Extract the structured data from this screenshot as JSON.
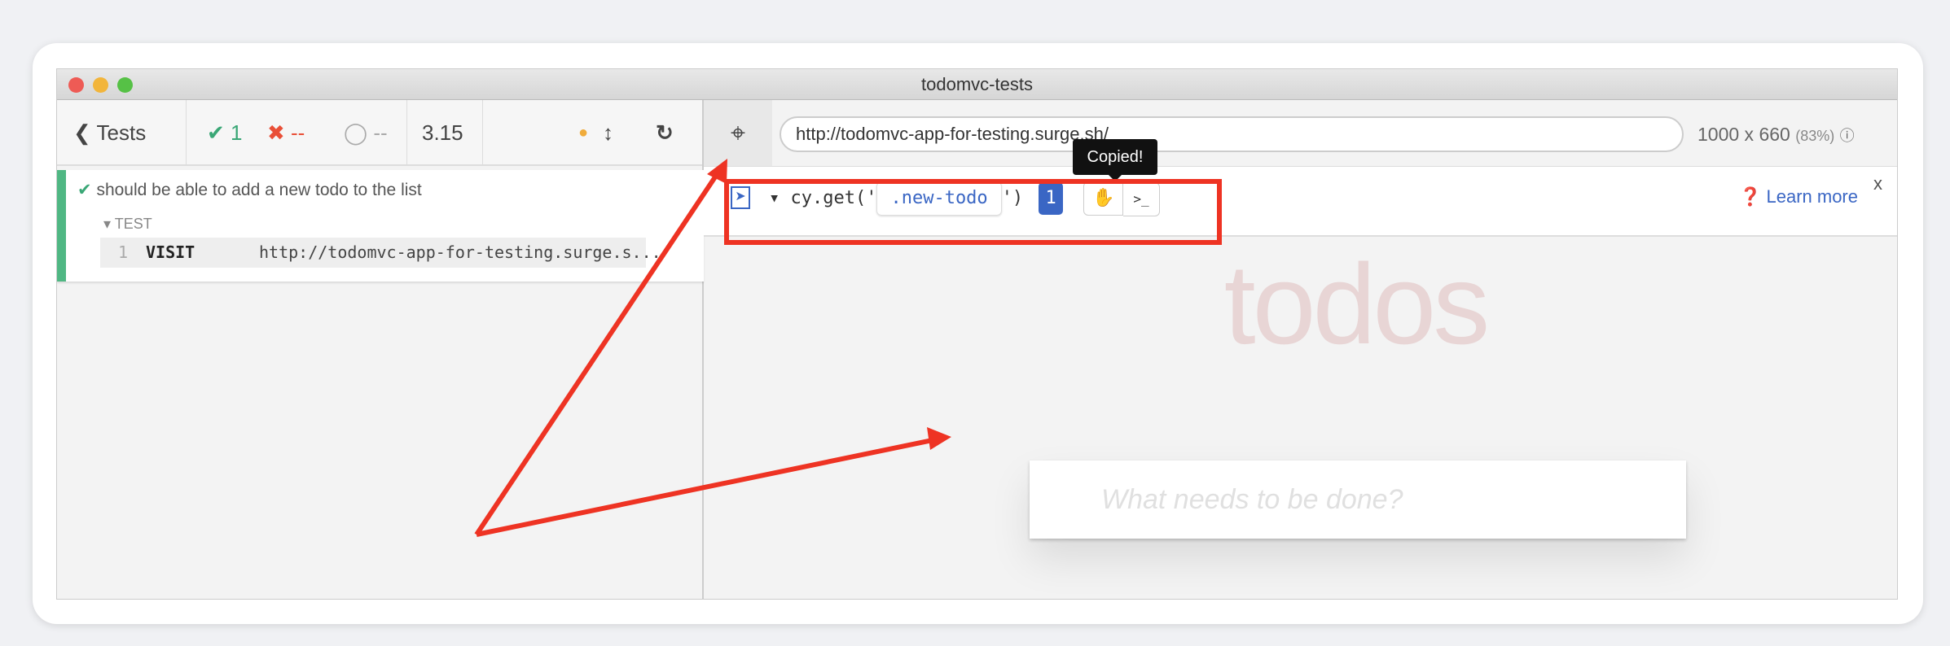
{
  "window": {
    "title": "todomvc-tests"
  },
  "toolbar": {
    "tests_label": "Tests",
    "passed": "1",
    "failed": "--",
    "pending": "--",
    "duration": "3.15"
  },
  "test": {
    "title": "should be able to add a new todo to the list",
    "section": "TEST",
    "command": {
      "index": "1",
      "name": "VISIT",
      "message": "http://todomvc-app-for-testing.surge.s..."
    }
  },
  "browser": {
    "url": "http://todomvc-app-for-testing.surge.sh/",
    "viewport": "1000 x 660",
    "scale": "(83%)"
  },
  "selector_playground": {
    "method_prefix": "cy.get('",
    "selector": ".new-todo",
    "method_suffix": "')",
    "match_count": "1",
    "tooltip": "Copied!",
    "console_label": ">_",
    "learn_more": "Learn more",
    "close": "x"
  },
  "app": {
    "heading": "todos",
    "input_placeholder": "What needs to be done?"
  },
  "colors": {
    "pass": "#3aa776",
    "fail": "#e94f37",
    "annotation": "#ee3323",
    "accent": "#3a66c4"
  }
}
